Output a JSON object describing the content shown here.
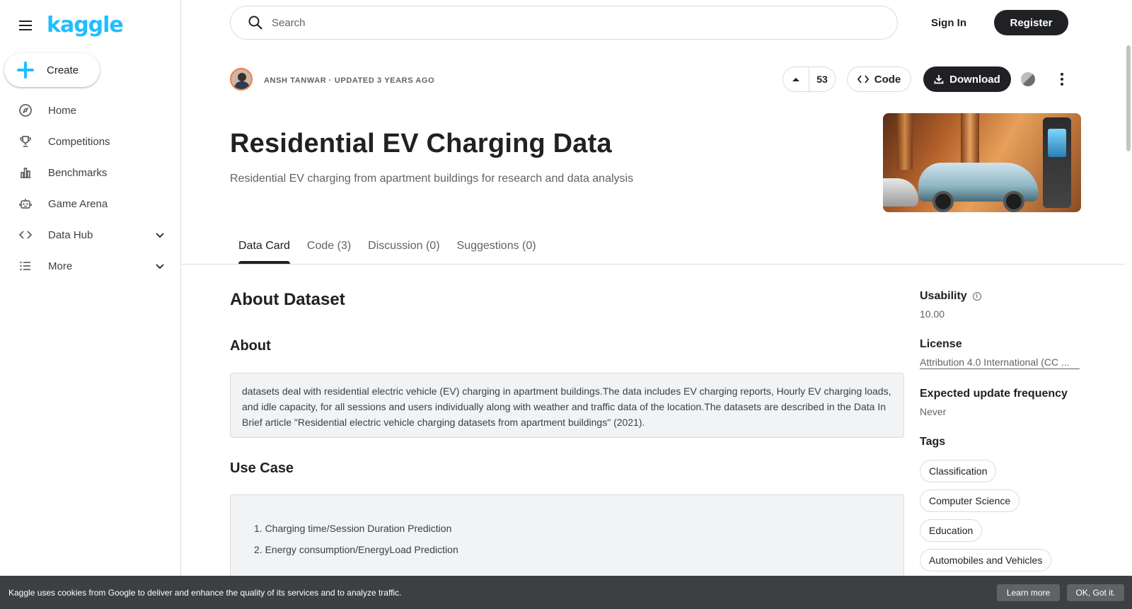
{
  "sidebar": {
    "logo": "kaggle",
    "create_label": "Create",
    "items": [
      {
        "label": "Home",
        "icon": "compass-icon"
      },
      {
        "label": "Competitions",
        "icon": "trophy-icon"
      },
      {
        "label": "Benchmarks",
        "icon": "bar-chart-icon"
      },
      {
        "label": "Game Arena",
        "icon": "robot-icon"
      },
      {
        "label": "Data Hub",
        "icon": "code-icon"
      },
      {
        "label": "More",
        "icon": "list-icon"
      }
    ]
  },
  "header": {
    "search_placeholder": "Search",
    "sign_in": "Sign In",
    "register": "Register"
  },
  "dataset": {
    "author_line": "ANSH TANWAR · UPDATED 3 YEARS AGO",
    "upvotes": "53",
    "code_label": "Code",
    "download_label": "Download",
    "title": "Residential EV Charging Data",
    "subtitle": "Residential EV charging from apartment buildings for research and data analysis"
  },
  "tabs": [
    {
      "label": "Data Card",
      "active": true
    },
    {
      "label": "Code (3)",
      "active": false
    },
    {
      "label": "Discussion (0)",
      "active": false
    },
    {
      "label": "Suggestions (0)",
      "active": false
    }
  ],
  "content": {
    "about_dataset_heading": "About Dataset",
    "about_heading": "About",
    "about_text": "datasets deal with residential electric vehicle (EV) charging in apartment buildings.The data includes EV charging reports, Hourly EV charging loads, and idle capacity, for all sessions and users individually along with weather and traffic data of the location.The datasets are described in the Data In Brief article \"Residential electric vehicle charging datasets from apartment buildings\" (2021).",
    "use_case_heading": "Use Case",
    "use_cases": [
      "1. Charging time/Session Duration Prediction",
      "2. Energy consumption/EnergyLoad Prediction"
    ]
  },
  "meta": {
    "usability_label": "Usability",
    "usability_value": "10.00",
    "license_label": "License",
    "license_value": "Attribution 4.0 International (CC ...",
    "update_label": "Expected update frequency",
    "update_value": "Never",
    "tags_label": "Tags",
    "tags": [
      "Classification",
      "Computer Science",
      "Education",
      "Automobiles and Vehicles"
    ]
  },
  "cookie": {
    "message": "Kaggle uses cookies from Google to deliver and enhance the quality of its services and to analyze traffic.",
    "learn_more": "Learn more",
    "ok": "OK, Got it."
  },
  "colors": {
    "brand": "#20beff",
    "dark": "#202124",
    "border": "#dadce0"
  }
}
